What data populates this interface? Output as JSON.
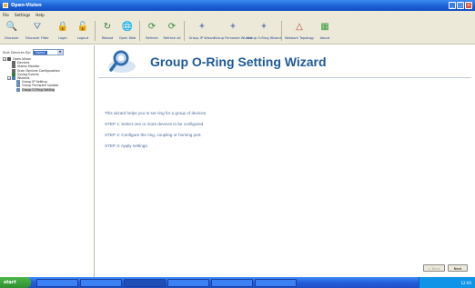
{
  "window": {
    "title": "Open-Vision",
    "min_label": "_",
    "max_label": "□",
    "close_label": "×"
  },
  "menu": [
    "File",
    "Settings",
    "Help"
  ],
  "toolbar": [
    {
      "label": "Discover",
      "icon": "magnifier-icon",
      "glyph": "🔍",
      "color": "#2f5fa8"
    },
    {
      "label": "Discover Filter",
      "icon": "filter-icon",
      "glyph": "⛛",
      "color": "#5a7fb8"
    },
    {
      "label": "Login",
      "icon": "login-icon",
      "glyph": "🔒",
      "color": "#c98b1e"
    },
    {
      "label": "Logout",
      "icon": "logout-icon",
      "glyph": "🔓",
      "color": "#c98b1e"
    },
    {
      "label": "Reboot",
      "icon": "reboot-icon",
      "glyph": "↻",
      "color": "#3a7a3a"
    },
    {
      "label": "Open Web",
      "icon": "globe-icon",
      "glyph": "🌐",
      "color": "#2f6fbf"
    },
    {
      "label": "Refresh",
      "icon": "refresh-icon",
      "glyph": "⟳",
      "color": "#3a8a3a"
    },
    {
      "label": "Refresh all",
      "icon": "refresh-all-icon",
      "glyph": "⟳",
      "color": "#3a8a3a"
    },
    {
      "label": "Group IP Wizard",
      "icon": "ip-wizard-icon",
      "glyph": "✦",
      "color": "#7a8fb8"
    },
    {
      "label": "Group Firmware Wizard",
      "icon": "firmware-wizard-icon",
      "glyph": "✦",
      "color": "#7a8fb8"
    },
    {
      "label": "Group O-Ring Wizard",
      "icon": "oring-wizard-icon",
      "glyph": "✦",
      "color": "#7a8fb8"
    },
    {
      "label": "Network Topology",
      "icon": "topology-icon",
      "glyph": "△",
      "color": "#c04030"
    },
    {
      "label": "About",
      "icon": "about-icon",
      "glyph": "▦",
      "color": "#3a9a3a"
    }
  ],
  "sort": {
    "label": "Sort Devices By:",
    "value": "Name"
  },
  "tree": [
    {
      "label": "Open-Vision",
      "level": 0,
      "color": "#555",
      "expander": "−"
    },
    {
      "label": "Devices",
      "level": 1,
      "color": "#666"
    },
    {
      "label": "Status Monitor",
      "level": 1,
      "color": "#666"
    },
    {
      "label": "Scan Devices Configuration",
      "level": 1,
      "color": "#666"
    },
    {
      "label": "Syslog Events",
      "level": 1,
      "color": "#2f7f2f"
    },
    {
      "label": "Wizards",
      "level": 1,
      "color": "#4a7ab8",
      "expander": "−"
    },
    {
      "label": "Group IP Setting",
      "level": 2,
      "color": "#6a8ab8"
    },
    {
      "label": "Group Firmware Update",
      "level": 2,
      "color": "#6a8ab8"
    },
    {
      "label": "Group O-Ring Setting",
      "level": 2,
      "color": "#6a8ab8",
      "selected": true
    }
  ],
  "wizard": {
    "title": "Group O-Ring Setting Wizard",
    "intro": "This wizard helps you to set ring for a group of devices.",
    "steps": [
      "STEP 1: Select one or more devices to be configured.",
      "STEP 2: Configure the ring, coupling or homing port.",
      "STEP 3: Apply settings."
    ],
    "back_label": "< Back",
    "next_label": "Next"
  },
  "colors": {
    "title_blue": "#1f5a96",
    "text_blue": "#4a6a9a",
    "xp_blue": "#245edb",
    "selection": "#316ac5"
  },
  "taskbar": {
    "start_label": "start",
    "clock": "12:00"
  }
}
